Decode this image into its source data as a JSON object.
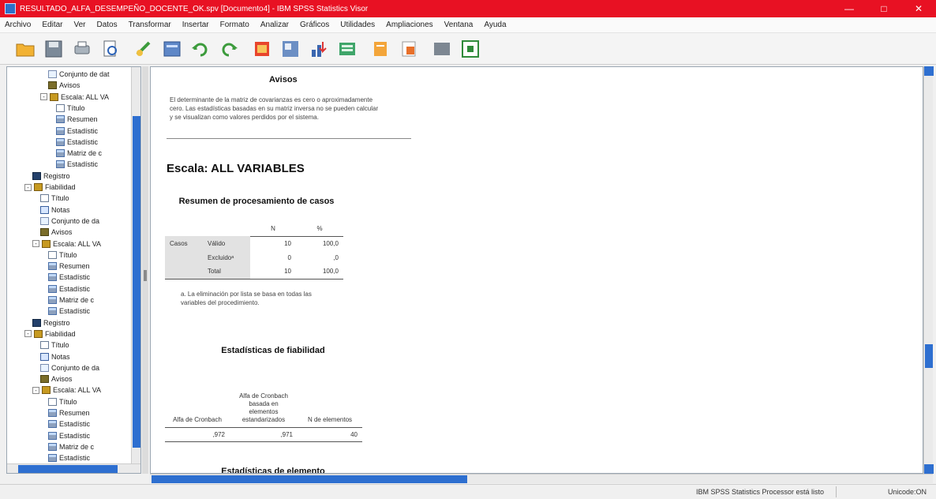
{
  "window": {
    "title": "RESULTADO_ALFA_DESEMPEÑO_DOCENTE_OK.spv [Documento4] - IBM SPSS Statistics Visor",
    "minimize": "—",
    "maximize": "□",
    "close": "✕"
  },
  "menu": [
    "Archivo",
    "Editar",
    "Ver",
    "Datos",
    "Transformar",
    "Insertar",
    "Formato",
    "Analizar",
    "Gráficos",
    "Utilidades",
    "Ampliaciones",
    "Ventana",
    "Ayuda"
  ],
  "toolbar": {
    "icons": [
      "open-folder-icon",
      "save-icon",
      "print-icon",
      "print-preview-icon",
      "export-icon",
      "recall-dialog-icon",
      "undo-icon",
      "redo-icon",
      "goto-data-icon",
      "goto-case-icon",
      "variables-icon",
      "insert-heading-icon",
      "insert-title-icon",
      "insert-text-icon",
      "show-all-icon",
      "select-last-output-icon"
    ]
  },
  "navigator": {
    "items": [
      {
        "label": "Conjunto de dat",
        "icon": "dataset-icon",
        "level": 3,
        "exp": ""
      },
      {
        "label": "Avisos",
        "icon": "warnings-icon",
        "level": 3,
        "exp": ""
      },
      {
        "label": "Escala: ALL VA",
        "icon": "scale-folder-icon",
        "level": 2,
        "exp": "-"
      },
      {
        "label": "Título",
        "icon": "title-icon",
        "level": 4,
        "exp": ""
      },
      {
        "label": "Resumen",
        "icon": "table-icon",
        "level": 4,
        "exp": ""
      },
      {
        "label": "Estadístic",
        "icon": "table-icon",
        "level": 4,
        "exp": ""
      },
      {
        "label": "Estadístic",
        "icon": "table-icon",
        "level": 4,
        "exp": ""
      },
      {
        "label": "Matriz de c",
        "icon": "table-icon",
        "level": 4,
        "exp": ""
      },
      {
        "label": "Estadístic",
        "icon": "table-icon",
        "level": 4,
        "exp": ""
      },
      {
        "label": "Registro",
        "icon": "log-icon",
        "level": 1,
        "exp": ""
      },
      {
        "label": "Fiabilidad",
        "icon": "reliability-folder-icon",
        "level": 0,
        "exp": "-"
      },
      {
        "label": "Título",
        "icon": "title-icon",
        "level": 2,
        "exp": ""
      },
      {
        "label": "Notas",
        "icon": "notes-icon",
        "level": 2,
        "exp": ""
      },
      {
        "label": "Conjunto de da",
        "icon": "dataset-icon",
        "level": 2,
        "exp": ""
      },
      {
        "label": "Avisos",
        "icon": "warnings-icon",
        "level": 2,
        "exp": ""
      },
      {
        "label": "Escala: ALL VA",
        "icon": "scale-folder-icon",
        "level": 1,
        "exp": "-"
      },
      {
        "label": "Título",
        "icon": "title-icon",
        "level": 3,
        "exp": ""
      },
      {
        "label": "Resumen",
        "icon": "table-icon",
        "level": 3,
        "exp": ""
      },
      {
        "label": "Estadístic",
        "icon": "table-icon",
        "level": 3,
        "exp": ""
      },
      {
        "label": "Estadístic",
        "icon": "table-icon",
        "level": 3,
        "exp": ""
      },
      {
        "label": "Matriz de c",
        "icon": "table-icon",
        "level": 3,
        "exp": ""
      },
      {
        "label": "Estadístic",
        "icon": "table-icon",
        "level": 3,
        "exp": ""
      },
      {
        "label": "Registro",
        "icon": "log-icon",
        "level": 1,
        "exp": ""
      },
      {
        "label": "Fiabilidad",
        "icon": "reliability-folder-icon",
        "level": 0,
        "exp": "-"
      },
      {
        "label": "Título",
        "icon": "title-icon",
        "level": 2,
        "exp": ""
      },
      {
        "label": "Notas",
        "icon": "notes-icon",
        "level": 2,
        "exp": ""
      },
      {
        "label": "Conjunto de da",
        "icon": "dataset-icon",
        "level": 2,
        "exp": ""
      },
      {
        "label": "Avisos",
        "icon": "warnings-icon",
        "level": 2,
        "exp": ""
      },
      {
        "label": "Escala: ALL VA",
        "icon": "scale-folder-icon",
        "level": 1,
        "exp": "-"
      },
      {
        "label": "Título",
        "icon": "title-icon",
        "level": 3,
        "exp": ""
      },
      {
        "label": "Resumen",
        "icon": "table-icon",
        "level": 3,
        "exp": ""
      },
      {
        "label": "Estadístic",
        "icon": "table-icon",
        "level": 3,
        "exp": ""
      },
      {
        "label": "Estadístic",
        "icon": "table-icon",
        "level": 3,
        "exp": ""
      },
      {
        "label": "Matriz de c",
        "icon": "table-icon",
        "level": 3,
        "exp": ""
      },
      {
        "label": "Estadístic",
        "icon": "table-icon",
        "level": 3,
        "exp": ""
      }
    ]
  },
  "output": {
    "warnings": {
      "title": "Avisos",
      "text": "El determinante de la matriz de covarianzas es cero o aproximadamente cero. Las estadísticas basadas en su matriz inversa no se pueden calcular y se visualizan como valores perdidos por el sistema."
    },
    "scale_heading": "Escala: ALL VARIABLES",
    "case_summary": {
      "title": "Resumen de procesamiento de casos",
      "col_n": "N",
      "col_pct": "%",
      "row_group": "Casos",
      "rows": [
        {
          "label": "Válido",
          "n": "10",
          "pct": "100,0"
        },
        {
          "label": "Excluidoᵃ",
          "n": "0",
          "pct": ",0"
        },
        {
          "label": "Total",
          "n": "10",
          "pct": "100,0"
        }
      ],
      "footnote": "a. La eliminación por lista se basa en todas las variables del procedimiento."
    },
    "reliability": {
      "title": "Estadísticas de fiabilidad",
      "headers": [
        "Alfa de Cronbach",
        "Alfa de Cronbach basada en elementos estandarizados",
        "N de elementos"
      ],
      "values": [
        ",972",
        ",971",
        "40"
      ]
    },
    "next_heading": "Estadísticas de elemento"
  },
  "status": {
    "processor": "IBM SPSS Statistics Processor está listo",
    "encoding": "Unicode:ON"
  }
}
